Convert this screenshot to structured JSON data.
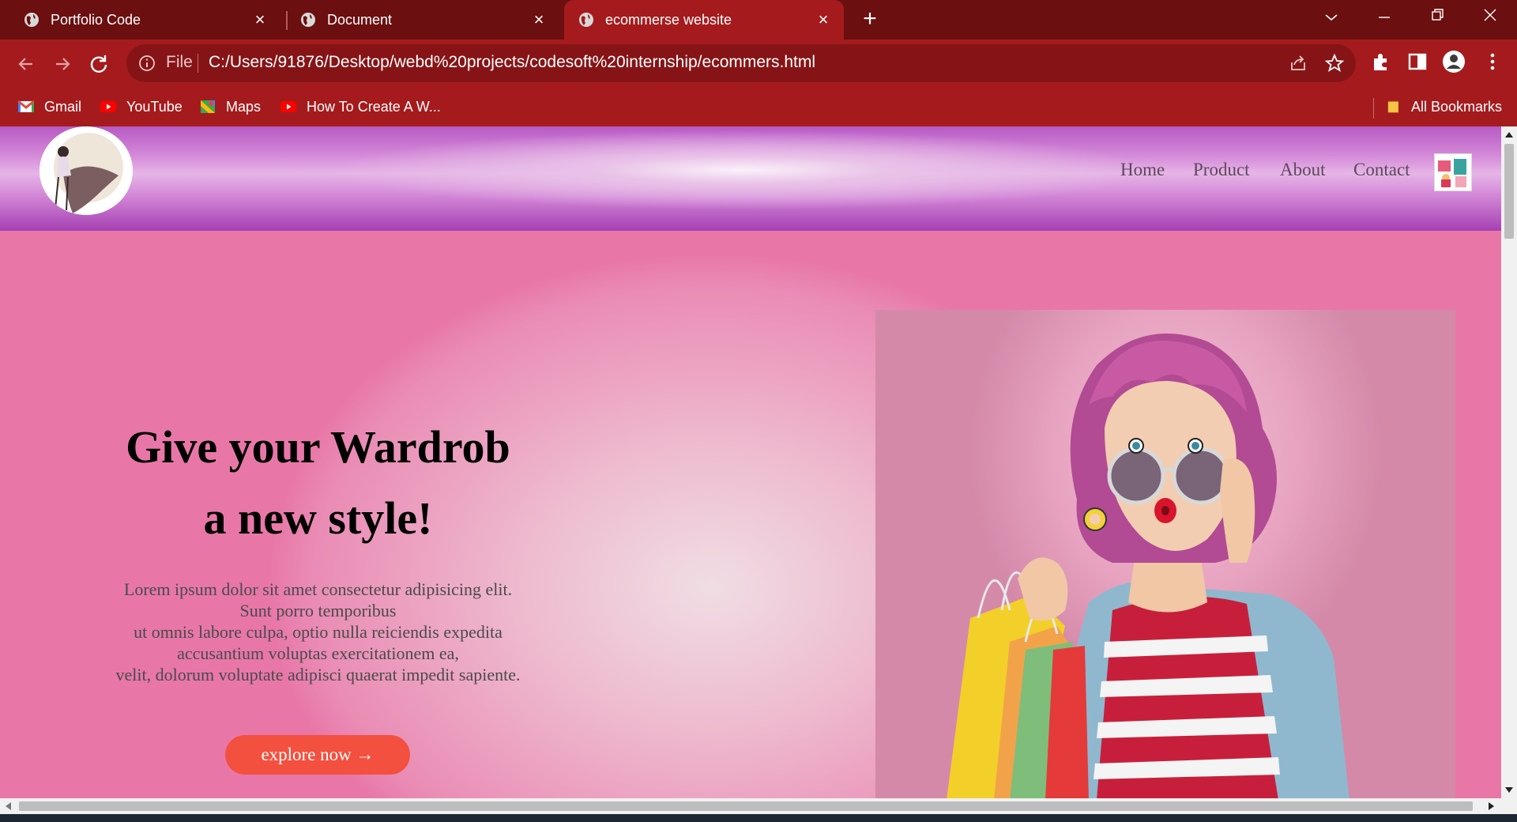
{
  "browser": {
    "tabs": [
      {
        "title": "Portfolio Code",
        "active": false
      },
      {
        "title": "Document",
        "active": false
      },
      {
        "title": "ecommerse website",
        "active": true
      }
    ],
    "address": {
      "file_label": "File",
      "url": "C:/Users/91876/Desktop/webd%20projects/codesoft%20internship/ecommers.html"
    },
    "bookmarks": [
      {
        "label": "Gmail",
        "icon": "gmail-icon"
      },
      {
        "label": "YouTube",
        "icon": "youtube-icon"
      },
      {
        "label": "Maps",
        "icon": "maps-icon"
      },
      {
        "label": "How To Create A W...",
        "icon": "youtube-icon"
      }
    ],
    "all_bookmarks": "All Bookmarks",
    "colors": {
      "tabbar": "#6b0f10",
      "toolbar": "#a51b1d",
      "omnibox": "#861416"
    }
  },
  "site": {
    "nav": [
      "Home",
      "Product",
      "About",
      "Contact"
    ],
    "hero": {
      "title_line1": "Give your Wardrob",
      "title_line2": "a new style!",
      "description": [
        "Lorem ipsum dolor sit amet consectetur adipisicing elit.",
        "Sunt porro temporibus",
        "ut omnis labore culpa, optio nulla reiciendis expedita",
        "accusantium voluptas exercitationem ea,",
        "velit, dolorum voluptate adipisci quaerat impedit sapiente."
      ],
      "cta": "explore now →"
    },
    "colors": {
      "header": "#c77ad0",
      "hero": "#ee85b0",
      "cta": "#f3503f"
    }
  }
}
